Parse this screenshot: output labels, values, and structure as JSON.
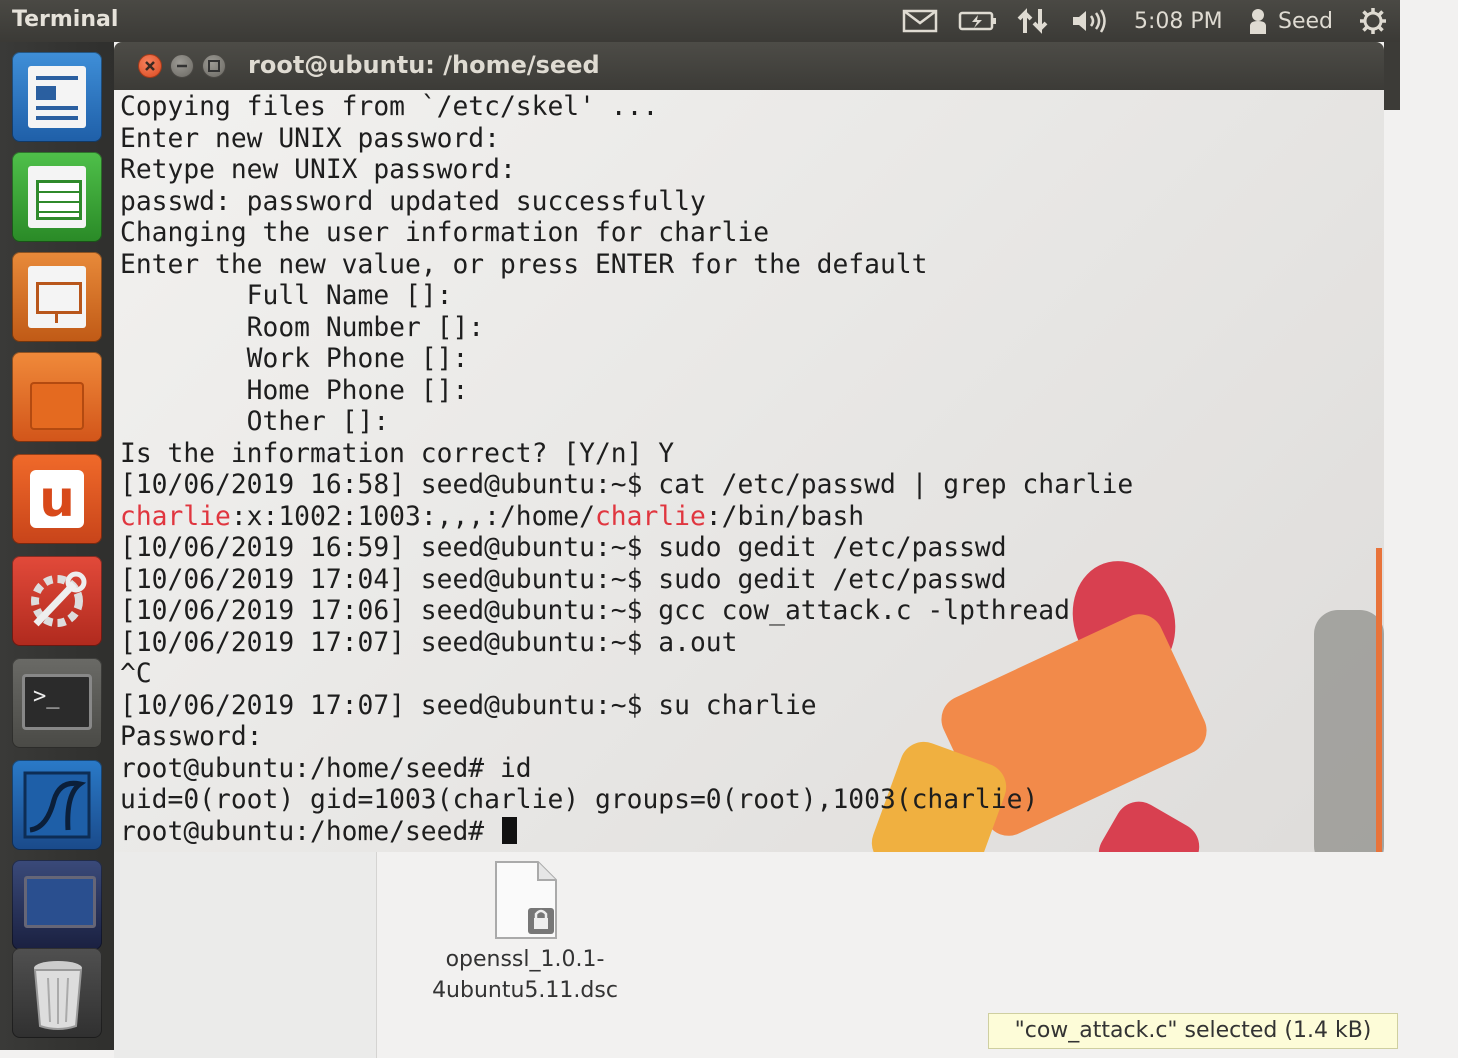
{
  "panel": {
    "app_title": "Terminal",
    "time": "5:08 PM",
    "user": "Seed",
    "icons": [
      "mail-icon",
      "battery-icon",
      "network-icon",
      "volume-icon",
      "user-icon",
      "gear-icon"
    ]
  },
  "launcher": {
    "items": [
      {
        "name": "libreoffice-writer",
        "icon": "document-icon"
      },
      {
        "name": "libreoffice-calc",
        "icon": "spreadsheet-icon"
      },
      {
        "name": "libreoffice-impress",
        "icon": "presentation-icon"
      },
      {
        "name": "software-center",
        "icon": "shopping-bag-icon"
      },
      {
        "name": "ubuntu-one",
        "icon": "u-icon"
      },
      {
        "name": "system-settings",
        "icon": "wrench-icon"
      },
      {
        "name": "terminal",
        "icon": "terminal-icon"
      },
      {
        "name": "wireshark",
        "icon": "shark-fin-icon"
      },
      {
        "name": "screenshot",
        "icon": "camera-icon"
      },
      {
        "name": "trash",
        "icon": "trash-icon"
      }
    ]
  },
  "window": {
    "title": "root@ubuntu: /home/seed",
    "lines": [
      "Copying files from `/etc/skel' ...",
      "Enter new UNIX password:",
      "Retype new UNIX password:",
      "passwd: password updated successfully",
      "Changing the user information for charlie",
      "Enter the new value, or press ENTER for the default",
      "        Full Name []:",
      "        Room Number []:",
      "        Work Phone []:",
      "        Home Phone []:",
      "        Other []:",
      "Is the information correct? [Y/n] Y",
      "[10/06/2019 16:58] seed@ubuntu:~$ cat /etc/passwd | grep charlie"
    ],
    "grep_line": {
      "p1": "charlie",
      "p2": ":x:1002:1003:,,,:/home/",
      "p3": "charlie",
      "p4": ":/bin/bash"
    },
    "lines2": [
      "[10/06/2019 16:59] seed@ubuntu:~$ sudo gedit /etc/passwd",
      "[10/06/2019 17:04] seed@ubuntu:~$ sudo gedit /etc/passwd",
      "[10/06/2019 17:06] seed@ubuntu:~$ gcc cow_attack.c -lpthread",
      "[10/06/2019 17:07] seed@ubuntu:~$ a.out",
      "^C",
      "[10/06/2019 17:07] seed@ubuntu:~$ su charlie",
      "Password:",
      "root@ubuntu:/home/seed# id",
      "uid=0(root) gid=1003(charlie) groups=0(root),1003(charlie)"
    ],
    "prompt": "root@ubuntu:/home/seed# "
  },
  "desktop": {
    "file_label_1": "openssl_1.0.1-",
    "file_label_2": "4ubuntu5.11.dsc",
    "status": "\"cow_attack.c\" selected (1.4 kB)"
  },
  "colors": {
    "highlight": "#e0363f",
    "accent_orange": "#e8733a"
  }
}
